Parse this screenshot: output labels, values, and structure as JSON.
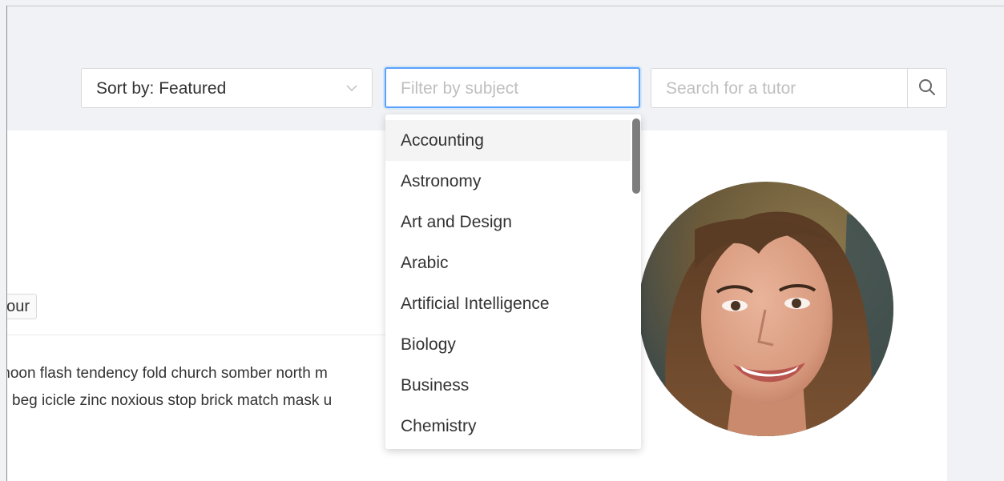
{
  "toolbar": {
    "sort_label": "Sort by: Featured",
    "filter_placeholder": "Filter by subject",
    "search_placeholder": "Search for a tutor"
  },
  "subject_dropdown": {
    "options": [
      "Accounting",
      "Astronomy",
      "Art and Design",
      "Arabic",
      "Artificial Intelligence",
      "Biology",
      "Business",
      "Chemistry"
    ],
    "highlighted": "Accounting"
  },
  "tutor_card": {
    "tag_text": "our",
    "bio_lines": [
      "moon flash tendency fold church somber north m",
      "beg icicle zinc noxious stop brick match mask u"
    ]
  },
  "colors": {
    "page_bg": "#f0f2f5",
    "focus_border": "#5aa2ff",
    "placeholder": "#bfbfbf",
    "highlight_bg": "#f4f4f4"
  },
  "icons": {
    "sort_chevron": "chevron-down-icon",
    "search": "search-icon"
  }
}
